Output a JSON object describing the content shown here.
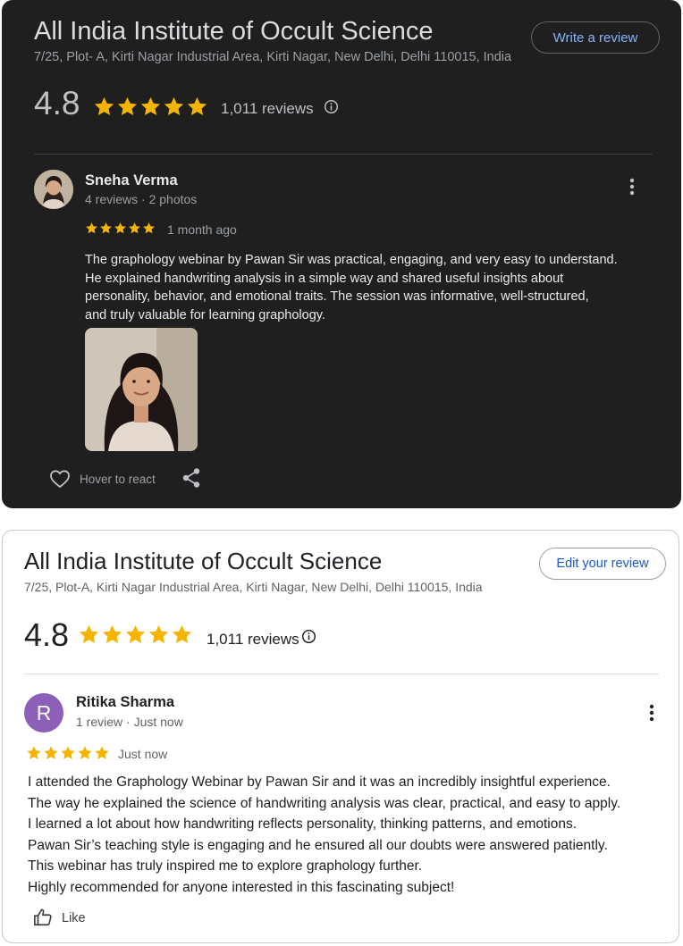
{
  "colors": {
    "star": "#f4b400",
    "dark_bg": "#1f1f1f",
    "link_blue_dark": "#8ab4f8",
    "link_blue_light": "#1a56c9",
    "avatar_purple": "#8e5fb8"
  },
  "dark_card": {
    "business_name": "All India Institute of Occult Science",
    "address": "7/25, Plot- A, Kirti Nagar Industrial Area, Kirti Nagar, New Delhi, Delhi 110015, India",
    "write_review_label": "Write a review",
    "rating": "4.8",
    "stars": 5,
    "review_count": "1,011 reviews",
    "review": {
      "reviewer_name": "Sneha Verma",
      "reviewer_meta": "4 reviews · 2 photos",
      "stars": 5,
      "time": "1 month ago",
      "lines": [
        "The graphology webinar by Pawan Sir was practical, engaging, and very easy to understand.",
        "He explained handwriting analysis in a simple way and shared useful insights about",
        "personality, behavior, and emotional traits. The session was informative, well-structured,",
        "and truly valuable for learning graphology."
      ],
      "react_label": "Hover to react"
    },
    "icons": [
      "info-icon",
      "more-vert-icon",
      "heart-icon",
      "share-icon"
    ]
  },
  "light_card": {
    "business_name": "All India Institute of Occult Science",
    "address": "7/25, Plot-A, Kirti Nagar  Industrial Area, Kirti Nagar, New Delhi, Delhi 110015,  India",
    "edit_review_label": "Edit your review",
    "rating": "4.8",
    "stars": 5,
    "review_count": "1,011 reviews",
    "review": {
      "avatar_letter": "R",
      "reviewer_name": "Ritika Sharma",
      "reviewer_meta": "1 review · Just now",
      "stars": 5,
      "time": "Just now",
      "lines": [
        "I attended the Graphology Webinar by Pawan Sir and it was an incredibly insightful experience.",
        "The way he explained the science of handwriting analysis was clear, practical, and easy to apply.",
        "I learned a lot about how handwriting reflects personality, thinking patterns, and emotions.",
        "Pawan Sir’s teaching style is engaging and he ensured all our doubts were answered patiently.",
        "This webinar has truly inspired me to explore graphology further.",
        "Highly recommended for anyone interested in this fascinating subject!"
      ],
      "like_label": "Like"
    },
    "icons": [
      "info-icon",
      "more-vert-icon",
      "thumbs-up-icon"
    ]
  }
}
